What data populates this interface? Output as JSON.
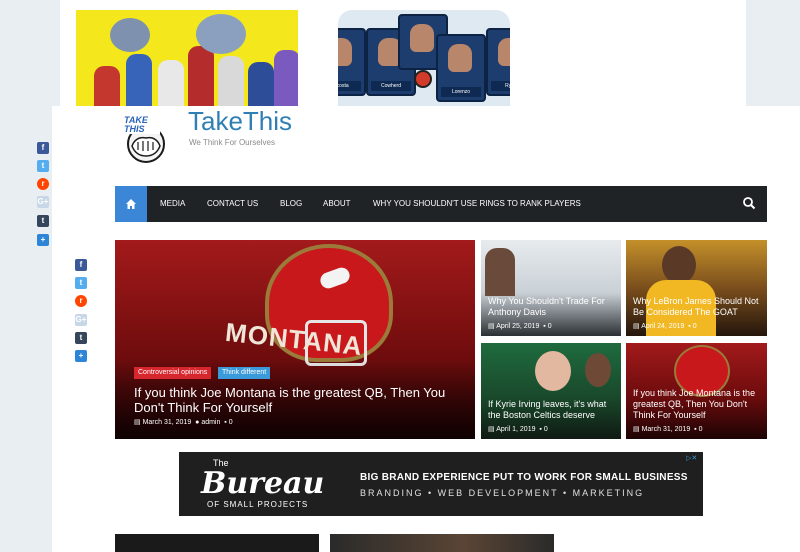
{
  "top_ads": {
    "tv_names": [
      "Acosta",
      "Cowherd",
      "",
      "Lorenzo",
      "Ryan"
    ],
    "tv_scores": [
      "00",
      "00",
      "",
      "30",
      "00"
    ]
  },
  "site": {
    "title": "TakeThis",
    "tagline": "We Think For Ourselves",
    "logo_text": "TAKE THIS"
  },
  "nav": {
    "home_icon": "home-icon",
    "items": [
      "MEDIA",
      "CONTACT US",
      "BLOG",
      "ABOUT",
      "WHY YOU SHOULDN'T USE RINGS TO RANK PLAYERS"
    ],
    "search_icon": "search-icon"
  },
  "share_icons": [
    "f",
    "t",
    "r",
    "G+",
    "t",
    "+"
  ],
  "featured": {
    "badges": [
      "Controversial opinions",
      "Think different"
    ],
    "title": "If you think Joe Montana is the greatest QB, Then You Don't Think For Yourself",
    "date": "March 31, 2019",
    "author": "admin",
    "comments": "0",
    "jersey_text": "MONTANA"
  },
  "tiles": [
    {
      "title": "Why You Shouldn't Trade For Anthony Davis",
      "date": "April 25, 2019",
      "comments": "0"
    },
    {
      "title": "Why LeBron James Should Not Be Considered The GOAT",
      "date": "April 24, 2019",
      "comments": "0"
    },
    {
      "title": "If Kyrie Irving leaves, it's what the Boston Celtics deserve",
      "date": "April 1, 2019",
      "comments": "0"
    },
    {
      "title": "If you think Joe Montana is the greatest QB, Then You Don't Think For Yourself",
      "date": "March 31, 2019",
      "comments": "0"
    }
  ],
  "ad": {
    "the": "The",
    "brand": "Bureau",
    "brand_sub": "OF SMALL PROJECTS",
    "headline": "BIG BRAND EXPERIENCE PUT TO WORK FOR SMALL BUSINESS",
    "services": "BRANDING  •  WEB DEVELOPMENT  •  MARKETING",
    "choices": "▷✕"
  },
  "colors": {
    "accent": "#3b86d7",
    "nav_bg": "#1f2326",
    "title_blue": "#2f7fb5",
    "badge_red": "#d6262e",
    "badge_blue": "#3b9ad9"
  }
}
